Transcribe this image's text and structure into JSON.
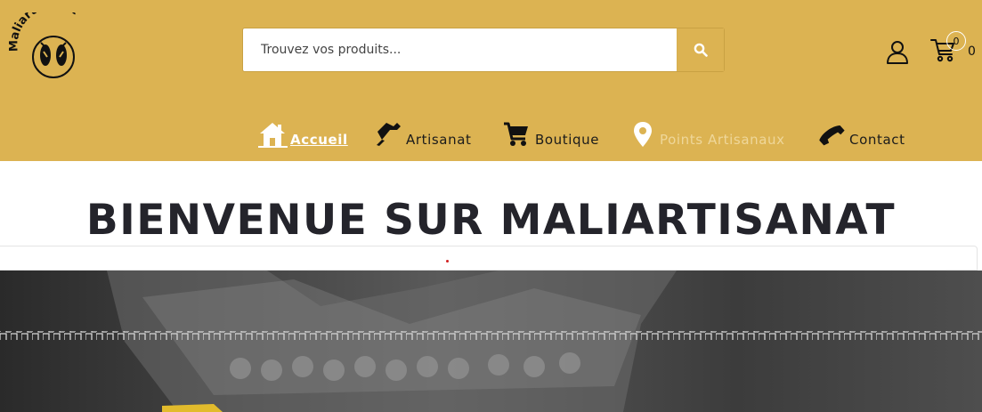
{
  "header": {
    "logo_text": "Maliartisanat",
    "background": "#dcb352"
  },
  "search": {
    "placeholder": "Trouvez vos produits...",
    "button_icon": "search-icon"
  },
  "account": {
    "icon": "user-icon"
  },
  "cart": {
    "icon": "cart-icon",
    "badge": "0",
    "count": "0"
  },
  "nav": {
    "items": [
      {
        "label": "Accueil",
        "icon": "home-icon",
        "active": true
      },
      {
        "label": "Artisanat",
        "icon": "hammer-icon"
      },
      {
        "label": "Boutique",
        "icon": "shopping-cart-icon"
      },
      {
        "label": "Points Artisanaux",
        "icon": "map-pin-icon"
      },
      {
        "label": "Contact",
        "icon": "phone-icon"
      }
    ]
  },
  "main": {
    "title": "BIENVENUE SUR MALIARTISANAT"
  }
}
